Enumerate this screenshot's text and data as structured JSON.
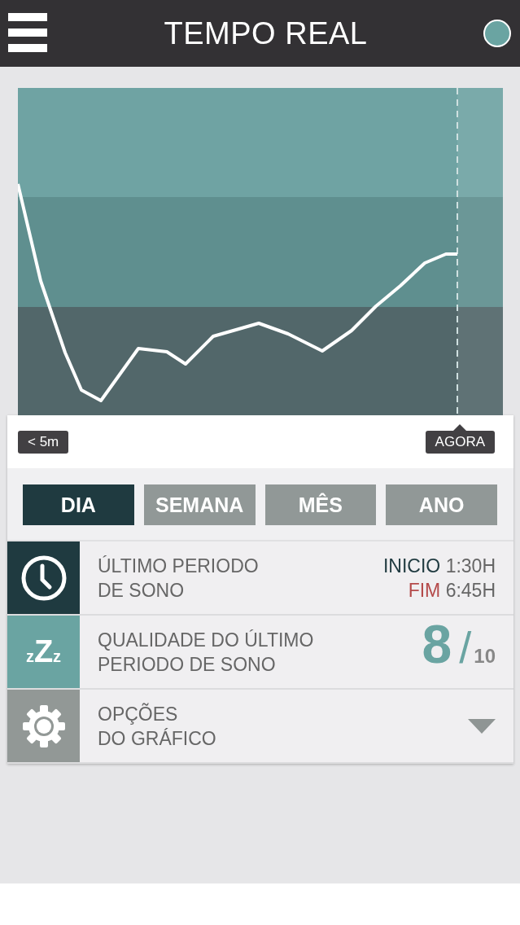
{
  "header": {
    "title": "TEMPO REAL"
  },
  "chart": {
    "start_label": "< 5m",
    "now_label": "AGORA"
  },
  "tabs": [
    {
      "label": "DIA",
      "selected": true
    },
    {
      "label": "SEMANA",
      "selected": false
    },
    {
      "label": "MÊS",
      "selected": false
    },
    {
      "label": "ANO",
      "selected": false
    }
  ],
  "rows": [
    {
      "kind": "period",
      "lines": [
        "ÚLTIMO PERIODO",
        "DE SONO"
      ],
      "start_label": "INICIO",
      "start_time": "1:30H",
      "end_label": "FIM",
      "end_time": "6:45H"
    },
    {
      "kind": "quality",
      "icon_text": "zZz",
      "lines": [
        "QUALIDADE DO ÚLTIMO",
        "PERIODO DE SONO"
      ],
      "score": "8",
      "separator": "/",
      "max": "10"
    },
    {
      "kind": "options",
      "lines": [
        "OPÇÕES",
        "DO GRÁFICO"
      ]
    }
  ]
}
